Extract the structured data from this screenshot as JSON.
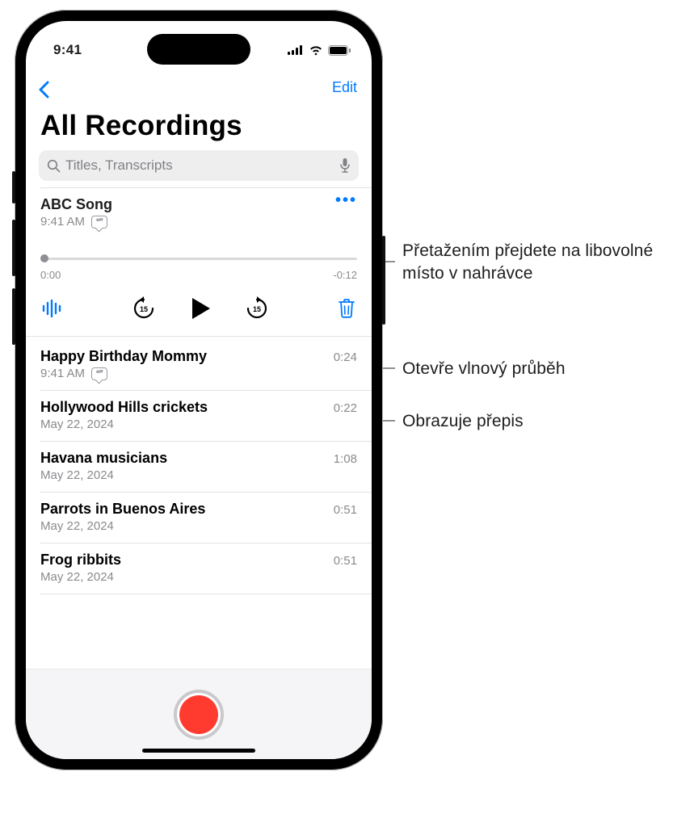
{
  "status": {
    "time": "9:41"
  },
  "nav": {
    "edit": "Edit"
  },
  "title": "All Recordings",
  "search": {
    "placeholder": "Titles, Transcripts"
  },
  "expanded": {
    "name": "ABC Song",
    "meta": "9:41 AM",
    "time_start": "0:00",
    "time_end": "-0:12"
  },
  "items": [
    {
      "name": "Happy Birthday Mommy",
      "meta": "9:41 AM",
      "duration": "0:24",
      "has_transcript": true
    },
    {
      "name": "Hollywood Hills crickets",
      "meta": "May 22, 2024",
      "duration": "0:22"
    },
    {
      "name": "Havana musicians",
      "meta": "May 22, 2024",
      "duration": "1:08"
    },
    {
      "name": "Parrots in Buenos Aires",
      "meta": "May 22, 2024",
      "duration": "0:51"
    },
    {
      "name": "Frog ribbits",
      "meta": "May 22, 2024",
      "duration": "0:51"
    }
  ],
  "callouts": {
    "drag": "Přetažením přejdete na libovolné místo v nahrávce",
    "waveform": "Otevře vlnový průběh",
    "transcript": "Obrazuje přepis"
  },
  "colors": {
    "accent": "#007aff",
    "record": "#ff3b30"
  }
}
